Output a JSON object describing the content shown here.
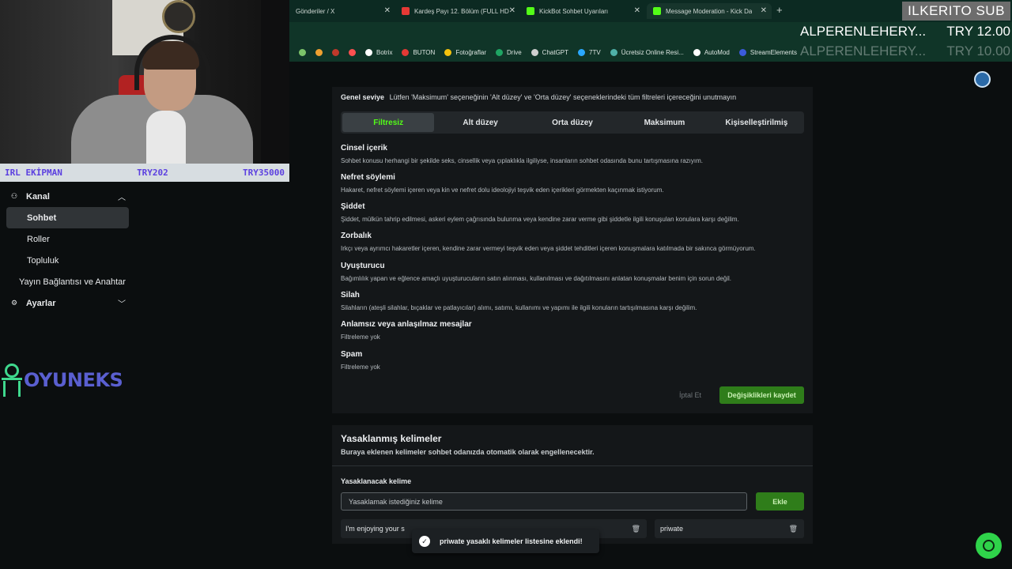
{
  "browser": {
    "tabs": [
      {
        "label": "Gönderiler / X",
        "icon_color": "#000000"
      },
      {
        "label": "Kardeş Payı 12. Bölüm (FULL HD",
        "icon_color": "#e53935"
      },
      {
        "label": "KickBot Sohbet Uyarıları",
        "icon_color": "#53fc18"
      },
      {
        "label": "Message Moderation - Kick Da",
        "icon_color": "#53fc18"
      }
    ],
    "new_tab": "+",
    "bookmarks": [
      {
        "label": "",
        "icon_color": "#7cc36a"
      },
      {
        "label": "",
        "icon_color": "#f0a030"
      },
      {
        "label": "",
        "icon_color": "#c0392b"
      },
      {
        "label": "",
        "icon_color": "#ff5050"
      },
      {
        "label": "Botrix",
        "icon_color": "#ffffff"
      },
      {
        "label": "BUTON",
        "icon_color": "#e53935"
      },
      {
        "label": "Fotoğraflar",
        "icon_color": "#f4c20d"
      },
      {
        "label": "Drive",
        "icon_color": "#1fa463"
      },
      {
        "label": "ChatGPT",
        "icon_color": "#cfcfcf"
      },
      {
        "label": "7TV",
        "icon_color": "#2aa8ff"
      },
      {
        "label": "Ücretsiz Online Resi...",
        "icon_color": "#4fb0a8"
      },
      {
        "label": "AutoMod",
        "icon_color": "#ffffff"
      },
      {
        "label": "StreamElements",
        "icon_color": "#3b5bdb"
      }
    ]
  },
  "overlay": {
    "stats_label": "IRL EKİPMAN",
    "stats_current": "TRY202",
    "stats_goal": "TRY35000",
    "sub_banner": "ILKERITO SUB",
    "donor_name": "ALPERENLEHERY...",
    "donor_amount": "TRY 12.00",
    "donor_name_faded": "ALPERENLEHERY...",
    "donor_amount_faded": "TRY 10.00",
    "logo_text": "OYUNEKS"
  },
  "sidebar": {
    "items": [
      {
        "label": "Kanal",
        "icon": "channel-icon",
        "chevron": "up"
      },
      {
        "label": "Sohbet",
        "active": true
      },
      {
        "label": "Roller"
      },
      {
        "label": "Topluluk"
      },
      {
        "label": "Yayın Bağlantısı ve Anahtar"
      },
      {
        "label": "Ayarlar",
        "icon": "gear-icon",
        "chevron": "down"
      }
    ]
  },
  "filters": {
    "level_label": "Genel seviye",
    "level_hint": "Lütfen 'Maksimum' seçeneğinin 'Alt düzey' ve 'Orta düzey' seçeneklerindeki tüm filtreleri içereceğini unutmayın",
    "options": [
      "Filtresiz",
      "Alt düzey",
      "Orta düzey",
      "Maksimum",
      "Kişiselleştirilmiş"
    ],
    "selected": "Filtresiz",
    "categories": [
      {
        "title": "Cinsel içerik",
        "desc": "Sohbet konusu herhangi bir şekilde seks, cinsellik veya çıplaklıkla ilgiliyse, insanların sohbet odasında bunu tartışmasına razıyım."
      },
      {
        "title": "Nefret söylemi",
        "desc": "Hakaret, nefret söylemi içeren veya kin ve nefret dolu ideolojiyi teşvik eden içerikleri görmekten kaçınmak istiyorum."
      },
      {
        "title": "Şiddet",
        "desc": "Şiddet, mülkün tahrip edilmesi, askeri eylem çağrısında bulunma veya kendine zarar verme gibi şiddetle ilgili konuşulan konulara karşı değilim."
      },
      {
        "title": "Zorbalık",
        "desc": "Irkçı veya ayrımcı hakaretler içeren, kendine zarar vermeyi teşvik eden veya şiddet tehditleri içeren konuşmalara katılmada bir sakınca görmüyorum."
      },
      {
        "title": "Uyuşturucu",
        "desc": "Bağımlılık yapan ve eğlence amaçlı uyuşturucuların satın alınması, kullanılması ve dağıtılmasını anlatan konuşmalar benim için sorun değil."
      },
      {
        "title": "Silah",
        "desc": "Silahların (ateşli silahlar, bıçaklar ve patlayıcılar) alımı, satımı, kullanımı ve yapımı ile ilgili konuların tartışılmasına karşı değilim."
      },
      {
        "title": "Anlamsız veya anlaşılmaz mesajlar",
        "desc": "Filtreleme yok"
      },
      {
        "title": "Spam",
        "desc": "Filtreleme yok"
      }
    ],
    "cancel_label": "İptal Et",
    "save_label": "Değişiklikleri kaydet"
  },
  "banned_words": {
    "title": "Yasaklanmış kelimeler",
    "desc": "Buraya eklenen kelimeler sohbet odanızda otomatik olarak engellenecektir.",
    "field_label": "Yasaklanacak kelime",
    "placeholder": "Yasaklamak istediğiniz kelime",
    "add_label": "Ekle",
    "words": [
      "I'm enjoying your s",
      "priwate"
    ]
  },
  "toast": {
    "message": "priwate yasaklı kelimeler listesine eklendi!"
  },
  "colors": {
    "accent": "#53fc18",
    "button_green": "#2f7d1a",
    "stats_text": "#5b3fe0"
  }
}
